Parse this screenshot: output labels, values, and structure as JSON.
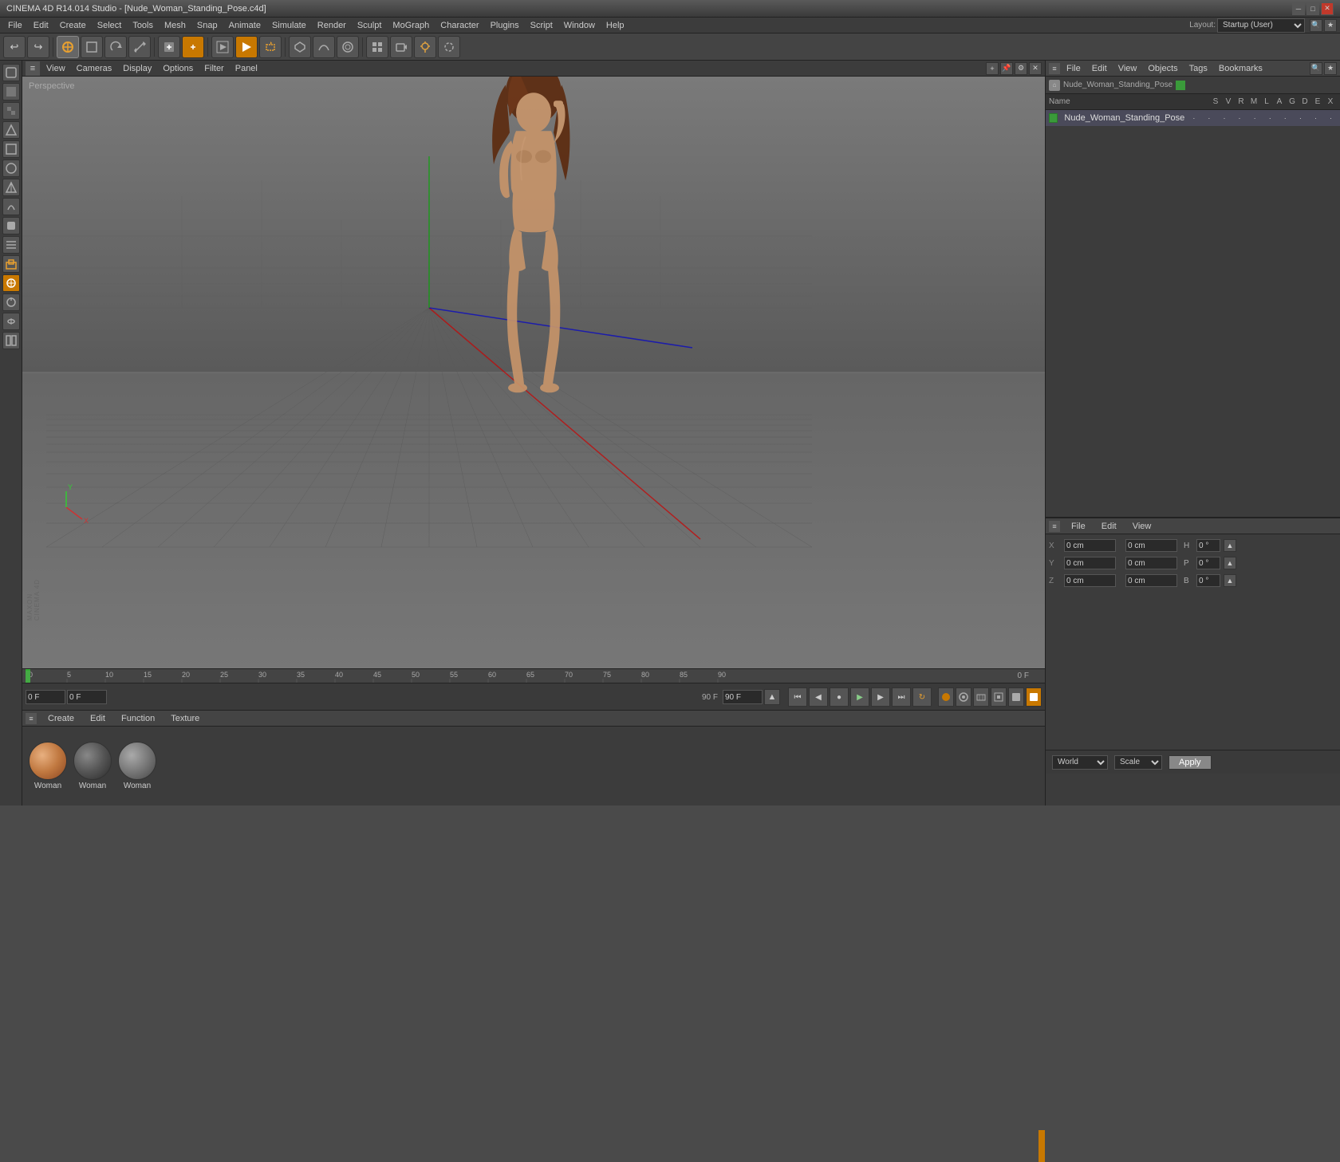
{
  "titlebar": {
    "title": "CINEMA 4D R14.014 Studio - [Nude_Woman_Standing_Pose.c4d]",
    "min_label": "─",
    "max_label": "□",
    "close_label": "✕"
  },
  "menubar": {
    "layout_label": "Layout:",
    "layout_value": "Startup (User)",
    "items": [
      "File",
      "Edit",
      "Create",
      "Select",
      "Tools",
      "Mesh",
      "Snap",
      "Animate",
      "Simulate",
      "Render",
      "Sculpt",
      "MoGraph",
      "Character",
      "Plugins",
      "Script",
      "Window",
      "Help"
    ]
  },
  "viewport": {
    "perspective_label": "Perspective",
    "view_menus": [
      "View",
      "Cameras",
      "Display",
      "Filter",
      "Options",
      "Panel"
    ]
  },
  "timeline": {
    "current_frame": "0 F",
    "end_frame": "90 F",
    "frame_display": "0 F",
    "frame_end_display": "90 F",
    "ruler_marks": [
      "0",
      "5",
      "10",
      "15",
      "20",
      "25",
      "30",
      "35",
      "40",
      "45",
      "50",
      "55",
      "60",
      "65",
      "70",
      "75",
      "80",
      "85",
      "90"
    ]
  },
  "material_panel": {
    "menus": [
      "Create",
      "Edit",
      "Function",
      "Texture"
    ],
    "materials": [
      {
        "name": "Woman",
        "type": "skin"
      },
      {
        "name": "Woman",
        "type": "dark"
      },
      {
        "name": "Woman",
        "type": "gray"
      }
    ]
  },
  "obj_manager": {
    "menus": [
      "File",
      "Edit",
      "View"
    ],
    "columns": {
      "name": "Name",
      "s": "S",
      "v": "V",
      "r": "R",
      "m": "M",
      "l": "L",
      "a": "A",
      "g": "G",
      "d": "D",
      "e": "E",
      "x": "X"
    },
    "breadcrumb": "Nude_Woman_Standing_Pose",
    "object_name": "Nude_Woman_Standing_Pose"
  },
  "attr_manager": {
    "menus": [
      "File",
      "Edit",
      "View"
    ],
    "coords": {
      "x_label": "X",
      "x_pos": "0 cm",
      "x_rot": "0°",
      "y_label": "Y",
      "y_pos": "0 cm",
      "y_rot": "0°",
      "z_label": "Z",
      "z_pos": "0 cm",
      "z_rot": "0°",
      "h_label": "H",
      "h_val": "0°",
      "p_label": "P",
      "p_val": "0°",
      "b_label": "B",
      "b_val": "0°",
      "size_x": "0 cm",
      "size_y": "0 cm",
      "size_z": "0 cm"
    },
    "world_label": "World",
    "scale_label": "Scale",
    "apply_label": "Apply"
  },
  "colors": {
    "accent_orange": "#c87800",
    "accent_green": "#3a9a3a",
    "bg_dark": "#3c3c3c",
    "bg_medium": "#444444",
    "bg_light": "#555555"
  },
  "icons": {
    "undo": "↩",
    "redo": "↪",
    "move": "✛",
    "rotate": "↻",
    "scale": "⤡",
    "new": "+",
    "object": "○",
    "poly": "◻",
    "spline": "~",
    "deformer": "⊡",
    "camera": "📷",
    "light": "💡",
    "render": "▶",
    "play": "▶",
    "stop": "■",
    "back": "◀",
    "forward": "▶",
    "first": "⏮",
    "last": "⏭",
    "record": "●"
  }
}
